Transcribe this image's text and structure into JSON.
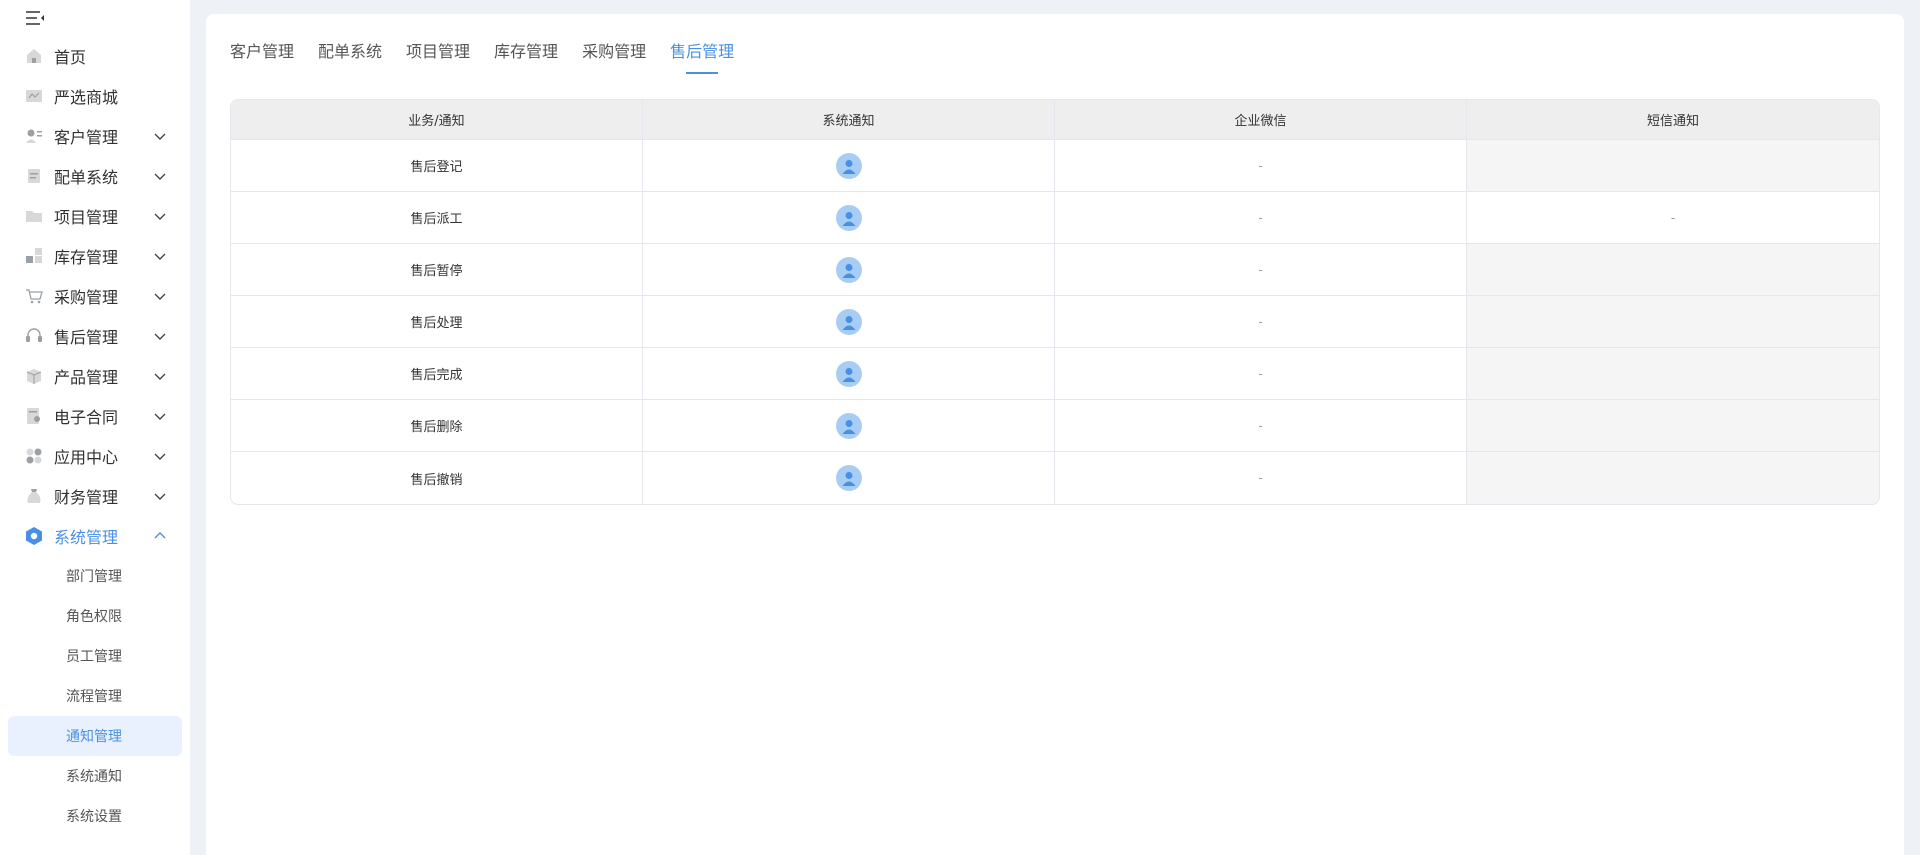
{
  "sidebar": {
    "menu": [
      {
        "label": "首页",
        "icon": "home-icon",
        "expandable": false
      },
      {
        "label": "严选商城",
        "icon": "store-icon",
        "expandable": false
      },
      {
        "label": "客户管理",
        "icon": "customer-icon",
        "expandable": true
      },
      {
        "label": "配单系统",
        "icon": "order-icon",
        "expandable": true
      },
      {
        "label": "项目管理",
        "icon": "folder-icon",
        "expandable": true
      },
      {
        "label": "库存管理",
        "icon": "inventory-icon",
        "expandable": true
      },
      {
        "label": "采购管理",
        "icon": "cart-icon",
        "expandable": true
      },
      {
        "label": "售后管理",
        "icon": "headset-icon",
        "expandable": true
      },
      {
        "label": "产品管理",
        "icon": "box-icon",
        "expandable": true
      },
      {
        "label": "电子合同",
        "icon": "contract-icon",
        "expandable": true
      },
      {
        "label": "应用中心",
        "icon": "apps-icon",
        "expandable": true
      },
      {
        "label": "财务管理",
        "icon": "money-bag-icon",
        "expandable": true
      },
      {
        "label": "系统管理",
        "icon": "settings-hex-icon",
        "expandable": true,
        "expanded": true,
        "active": true
      }
    ],
    "submenu": [
      {
        "label": "部门管理",
        "active": false
      },
      {
        "label": "角色权限",
        "active": false
      },
      {
        "label": "员工管理",
        "active": false
      },
      {
        "label": "流程管理",
        "active": false
      },
      {
        "label": "通知管理",
        "active": true
      },
      {
        "label": "系统通知",
        "active": false
      },
      {
        "label": "系统设置",
        "active": false
      }
    ]
  },
  "tabs": [
    {
      "label": "客户管理",
      "active": false
    },
    {
      "label": "配单系统",
      "active": false
    },
    {
      "label": "项目管理",
      "active": false
    },
    {
      "label": "库存管理",
      "active": false
    },
    {
      "label": "采购管理",
      "active": false
    },
    {
      "label": "售后管理",
      "active": true
    }
  ],
  "table": {
    "headers": [
      "业务/通知",
      "系统通知",
      "企业微信",
      "短信通知"
    ],
    "rows": [
      {
        "name": "售后登记",
        "system": "avatar",
        "wecom": "-",
        "sms": ""
      },
      {
        "name": "售后派工",
        "system": "avatar",
        "wecom": "-",
        "sms": "-"
      },
      {
        "name": "售后暂停",
        "system": "avatar",
        "wecom": "-",
        "sms": ""
      },
      {
        "name": "售后处理",
        "system": "avatar",
        "wecom": "-",
        "sms": ""
      },
      {
        "name": "售后完成",
        "system": "avatar",
        "wecom": "-",
        "sms": ""
      },
      {
        "name": "售后删除",
        "system": "avatar",
        "wecom": "-",
        "sms": ""
      },
      {
        "name": "售后撤销",
        "system": "avatar",
        "wecom": "-",
        "sms": ""
      }
    ]
  },
  "colors": {
    "accent": "#4a90e2",
    "avatar": "#a8cdf5",
    "disabled_cell": "#f5f5f5",
    "header_bg": "#eeeeee"
  }
}
